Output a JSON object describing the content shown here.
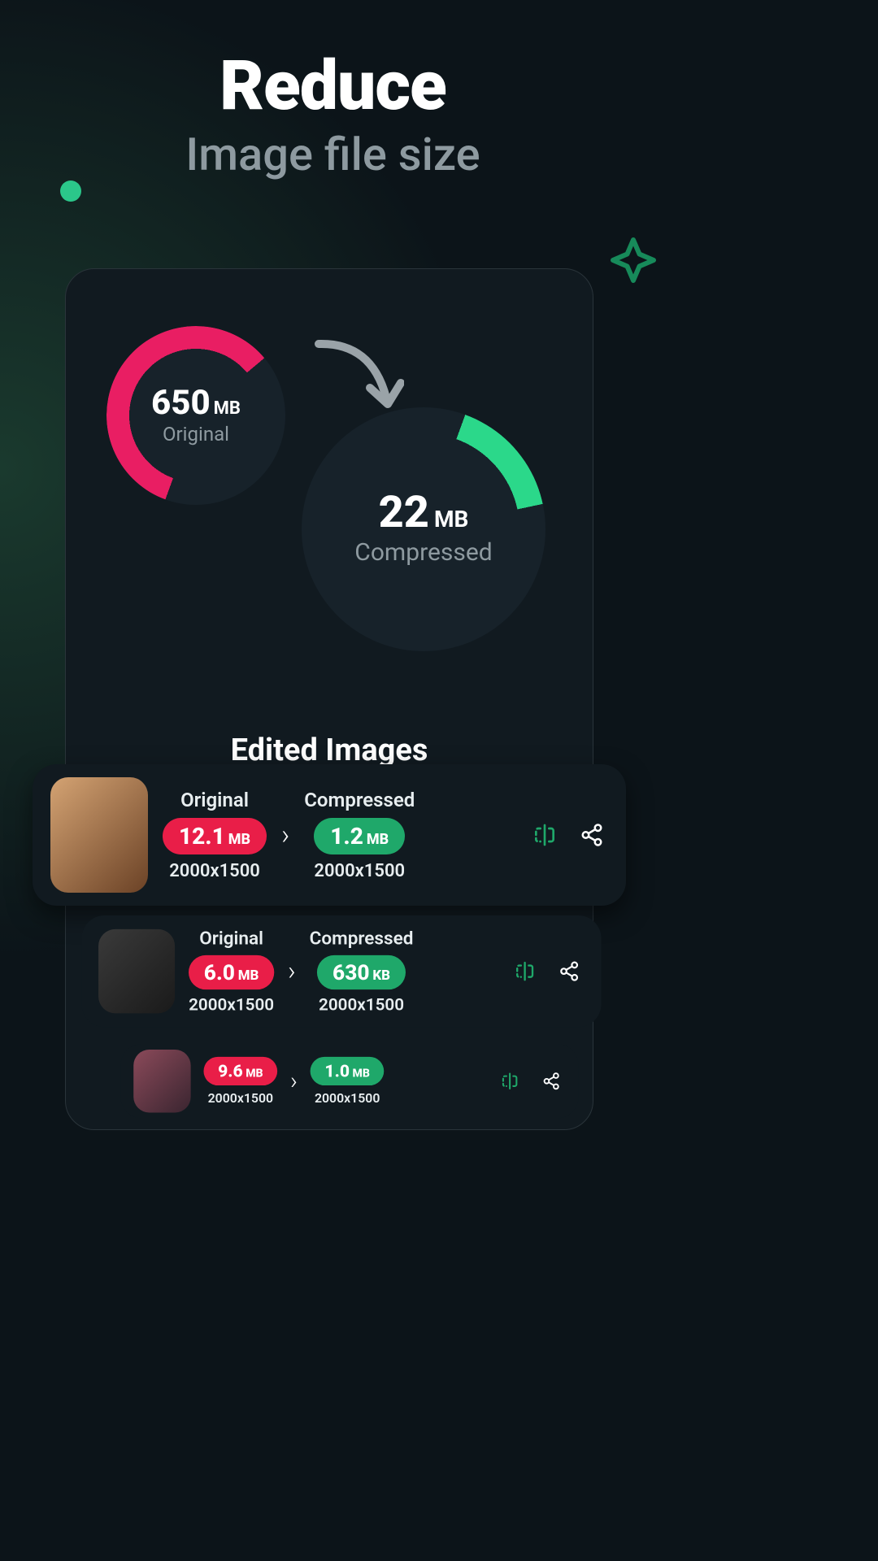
{
  "hero": {
    "title": "Reduce",
    "subtitle": "Image file size"
  },
  "summary": {
    "original": {
      "value": "650",
      "unit": "MB",
      "label": "Original"
    },
    "compressed": {
      "value": "22",
      "unit": "MB",
      "label": "Compressed"
    }
  },
  "section_title": "Edited Images",
  "labels": {
    "original": "Original",
    "compressed": "Compressed"
  },
  "colors": {
    "accent_pink": "#e91e48",
    "accent_green": "#2bd88a"
  },
  "items": [
    {
      "original": {
        "size": "12.1",
        "unit": "MB",
        "dims": "2000x1500"
      },
      "compressed": {
        "size": "1.2",
        "unit": "MB",
        "dims": "2000x1500"
      }
    },
    {
      "original": {
        "size": "6.0",
        "unit": "MB",
        "dims": "2000x1500"
      },
      "compressed": {
        "size": "630",
        "unit": "KB",
        "dims": "2000x1500"
      }
    },
    {
      "original": {
        "size": "9.6",
        "unit": "MB",
        "dims": "2000x1500"
      },
      "compressed": {
        "size": "1.0",
        "unit": "MB",
        "dims": "2000x1500"
      }
    }
  ]
}
